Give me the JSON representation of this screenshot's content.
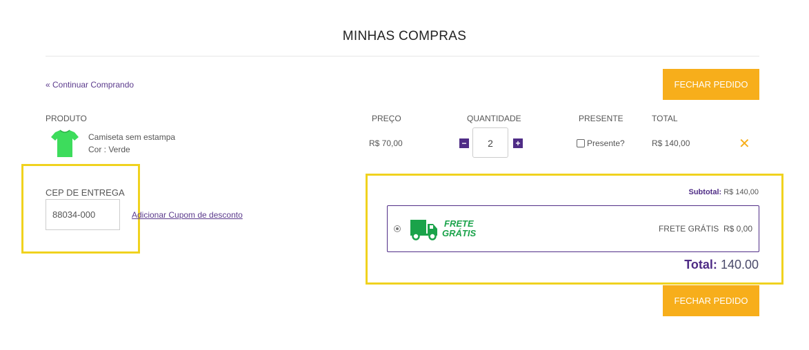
{
  "page": {
    "title": "MINHAS COMPRAS"
  },
  "nav": {
    "continue_label": "« Continuar Comprando"
  },
  "actions": {
    "checkout_label": "FECHAR PEDIDO"
  },
  "table": {
    "headers": {
      "product": "PRODUTO",
      "price": "PREÇO",
      "quantity": "QUANTIDADE",
      "gift": "PRESENTE",
      "total": "TOTAL"
    },
    "items": [
      {
        "name": "Camiseta sem estampa",
        "variant": "Cor : Verde",
        "price": "R$ 70,00",
        "quantity": "2",
        "gift_label": "Presente?",
        "total": "R$ 140,00"
      }
    ]
  },
  "shipping": {
    "cep_label": "CEP DE ENTREGA",
    "cep_value": "88034-000",
    "coupon_label": "Adicionar Cupom de desconto",
    "option_badge_line1": "FRETE",
    "option_badge_line2": "GRÁTIS",
    "option_name": "FRETE GRÁTIS",
    "option_price": "R$ 0,00"
  },
  "summary": {
    "subtotal_label": "Subtotal:",
    "subtotal_value": "R$ 140,00",
    "total_label": "Total:",
    "total_value": "140.00"
  },
  "colors": {
    "accent": "#4f2c86",
    "button": "#f7ae1b",
    "highlight": "#f0d21e",
    "free_shipping": "#1aa34a",
    "product": "#3ddc5c"
  }
}
